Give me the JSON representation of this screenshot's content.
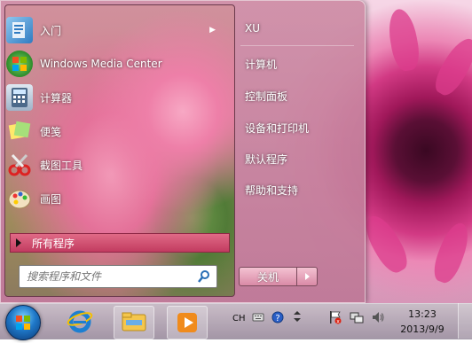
{
  "start_menu": {
    "programs": [
      {
        "label": "入门",
        "icon": "getting-started-icon",
        "has_submenu": true
      },
      {
        "label": "Windows Media Center",
        "icon": "windows-media-center-icon"
      },
      {
        "label": "计算器",
        "icon": "calculator-icon"
      },
      {
        "label": "便笺",
        "icon": "sticky-notes-icon"
      },
      {
        "label": "截图工具",
        "icon": "snipping-tool-icon"
      },
      {
        "label": "画图",
        "icon": "paint-icon"
      }
    ],
    "all_programs": "所有程序",
    "search_placeholder": "搜索程序和文件",
    "right_items": [
      {
        "label": "XU"
      },
      {
        "label": "计算机"
      },
      {
        "label": "控制面板"
      },
      {
        "label": "设备和打印机"
      },
      {
        "label": "默认程序"
      },
      {
        "label": "帮助和支持"
      }
    ],
    "shutdown_label": "关机"
  },
  "taskbar": {
    "apps": [
      "internet-explorer-icon",
      "windows-explorer-icon",
      "media-player-icon"
    ],
    "tray": {
      "language": "CH",
      "icons": [
        "keyboard-icon",
        "help-icon",
        "show-hidden-icons-icon",
        "action-center-flag-icon",
        "network-icon",
        "volume-icon"
      ]
    },
    "time": "13:23",
    "date": "2013/9/9"
  },
  "colors": {
    "accent": "#c23b60",
    "wallpaper": "#d23a84"
  }
}
